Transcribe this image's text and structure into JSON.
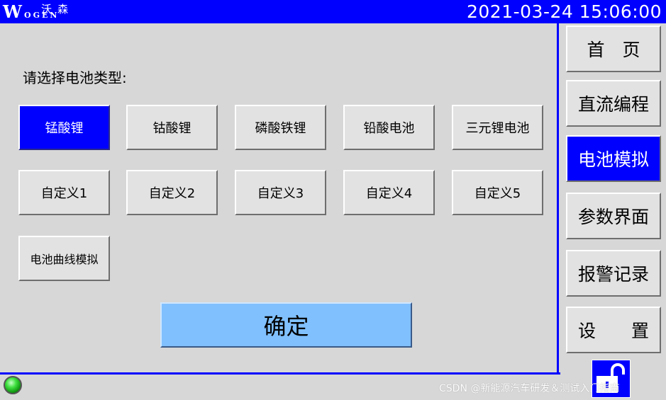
{
  "header": {
    "logo_latin": "WoGEN",
    "logo_cn": "沃森",
    "datetime": "2021-03-24 15:06:00"
  },
  "main": {
    "prompt": "请选择电池类型:",
    "battery_types": [
      {
        "label": "锰酸锂",
        "selected": true
      },
      {
        "label": "钴酸锂",
        "selected": false
      },
      {
        "label": "磷酸铁锂",
        "selected": false
      },
      {
        "label": "铅酸电池",
        "selected": false
      },
      {
        "label": "三元锂电池",
        "selected": false
      },
      {
        "label": "自定义1",
        "selected": false
      },
      {
        "label": "自定义2",
        "selected": false
      },
      {
        "label": "自定义3",
        "selected": false
      },
      {
        "label": "自定义4",
        "selected": false
      },
      {
        "label": "自定义5",
        "selected": false
      },
      {
        "label": "电池曲线模拟",
        "selected": false
      }
    ],
    "confirm_label": "确定"
  },
  "sidebar": {
    "items": [
      {
        "label": "首　页"
      },
      {
        "label": "直流编程"
      },
      {
        "label": "电池模拟",
        "active": true
      },
      {
        "label": "参数界面"
      },
      {
        "label": "报警记录"
      },
      {
        "label": "设　　置"
      }
    ],
    "lock_icon": "unlocked-padlock-icon"
  },
  "status": {
    "indicator_color": "#3fe03f"
  },
  "watermark": "CSDN @新能源汽车研发＆测试入门指南",
  "colors": {
    "accent": "#0000ff",
    "panel": "#d7d7d7",
    "confirm": "#80c0ff"
  }
}
